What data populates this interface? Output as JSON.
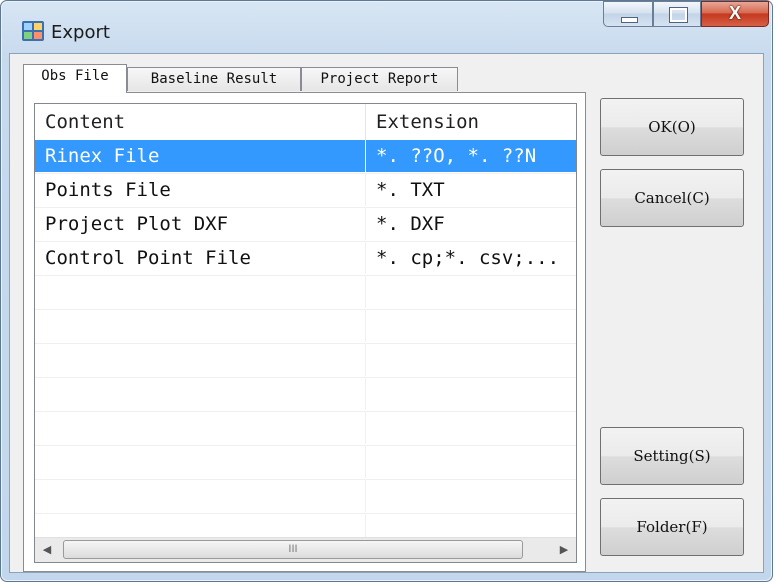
{
  "window": {
    "title": "Export",
    "close_glyph": "X"
  },
  "tabs": [
    {
      "label": "Obs File",
      "active": true
    },
    {
      "label": "Baseline Result",
      "active": false
    },
    {
      "label": "Project Report",
      "active": false
    }
  ],
  "list": {
    "columns": [
      "Content",
      "Extension"
    ],
    "rows": [
      {
        "content": "Rinex File",
        "extension": "*. ??O,  *. ??N",
        "selected": true
      },
      {
        "content": "Points File",
        "extension": "*. TXT",
        "selected": false
      },
      {
        "content": "Project Plot DXF",
        "extension": "*. DXF",
        "selected": false
      },
      {
        "content": "Control Point File",
        "extension": "*. cp;*. csv;...",
        "selected": false
      }
    ],
    "scrollbar_grip": "III"
  },
  "buttons": {
    "ok": "OK(O)",
    "cancel": "Cancel(C)",
    "setting": "Setting(S)",
    "folder": "Folder(F)"
  },
  "colors": {
    "selection": "#3399ff",
    "close_button": "#c4391f"
  }
}
